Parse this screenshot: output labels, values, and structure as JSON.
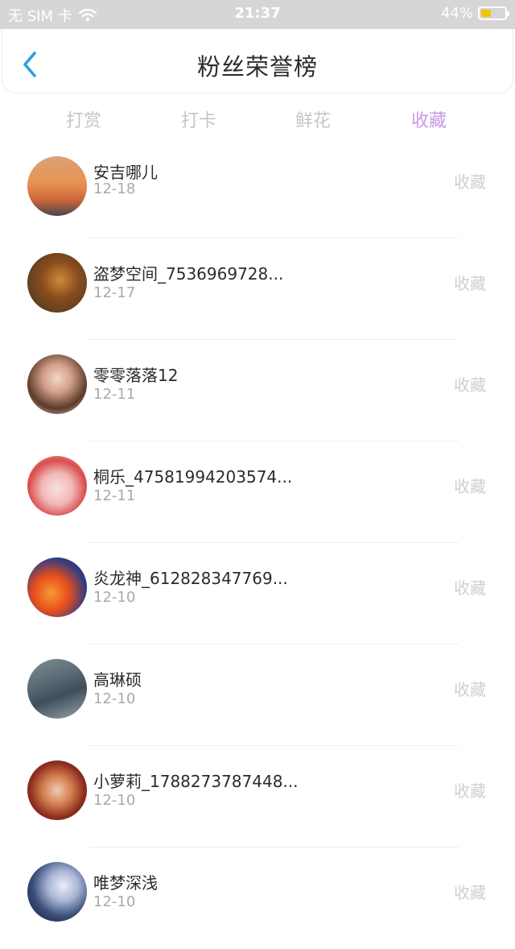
{
  "status_bar": {
    "carrier": "无 SIM 卡",
    "time": "21:37",
    "battery": "44%",
    "battery_level": 0.44,
    "icons": [
      "wifi-icon",
      "battery-icon"
    ]
  },
  "header": {
    "title": "粉丝荣誉榜",
    "back_icon": "chevron-left-icon",
    "accent": "#2d9ee0"
  },
  "tabs": [
    {
      "label": "打赏",
      "active": false
    },
    {
      "label": "打卡",
      "active": false
    },
    {
      "label": "鲜花",
      "active": false
    },
    {
      "label": "收藏",
      "active": true
    }
  ],
  "colors": {
    "active_tab": "#c79ae3",
    "inactive_tab": "#c6c6c6",
    "status_bar_bg": "#d6d6d6"
  },
  "list": [
    {
      "name": "安吉哪儿",
      "date": "12-18",
      "action": "收藏"
    },
    {
      "name": "盗梦空间_7536969728...",
      "date": "12-17",
      "action": "收藏"
    },
    {
      "name": "零零落落12",
      "date": "12-11",
      "action": "收藏"
    },
    {
      "name": "桐乐_47581994203574...",
      "date": "12-11",
      "action": "收藏"
    },
    {
      "name": "炎龙神_612828347769...",
      "date": "12-10",
      "action": "收藏"
    },
    {
      "name": "高琳硕",
      "date": "12-10",
      "action": "收藏"
    },
    {
      "name": "小萝莉_1788273787448...",
      "date": "12-10",
      "action": "收藏"
    },
    {
      "name": "唯梦深浅",
      "date": "12-10",
      "action": "收藏"
    }
  ]
}
